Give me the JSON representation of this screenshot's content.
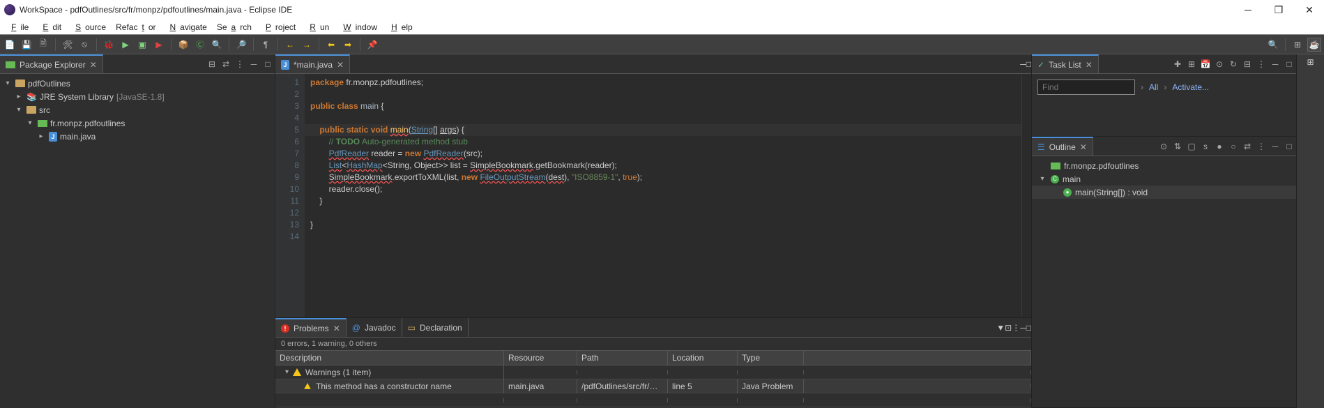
{
  "title": "WorkSpace - pdfOutlines/src/fr/monpz/pdfoutlines/main.java - Eclipse IDE",
  "menu": [
    "File",
    "Edit",
    "Source",
    "Refactor",
    "Navigate",
    "Search",
    "Project",
    "Run",
    "Window",
    "Help"
  ],
  "menu_mnemonic": [
    "F",
    "E",
    "S",
    "t",
    "N",
    "a",
    "P",
    "R",
    "W",
    "H"
  ],
  "pkgexp": {
    "title": "Package Explorer",
    "project": "pdfOutlines",
    "jre": {
      "label": "JRE System Library",
      "version": "[JavaSE-1.8]"
    },
    "srcfolder": "src",
    "pkg": "fr.monpz.pdfoutlines",
    "file": "main.java"
  },
  "editor": {
    "tab": "*main.java",
    "lines": [
      {
        "n": 1,
        "html": "<span class='kw'>package</span> fr.monpz.pdfoutlines;"
      },
      {
        "n": 2,
        "html": ""
      },
      {
        "n": 3,
        "html": "<span class='kw'>public class</span> <span style='color:#a9b7c6'>main</span> {"
      },
      {
        "n": 4,
        "html": ""
      },
      {
        "n": 5,
        "html": "    <span class='kw'>public static void</span> <span class='mth err'>main</span>(<span class='cls'>String</span>[] <span style='text-decoration:underline'>args</span>) {",
        "marker": "warn-hl"
      },
      {
        "n": 6,
        "html": "        <span class='cmt'>// <b>TODO</b> Auto-generated method stub</span>"
      },
      {
        "n": 7,
        "html": "        <span class='cls err'>PdfReader</span> reader = <span class='kw'>new</span> <span class='cls err'>PdfReader</span>(src);",
        "marker": "err"
      },
      {
        "n": 8,
        "html": "        <span class='cls err'>List</span>&lt;<span class='cls err'>HashMap</span>&lt;String, Object&gt;&gt; list = <span class='err'>SimpleBookmark</span>.getBookmark(reader);",
        "marker": "err"
      },
      {
        "n": 9,
        "html": "        <span class='err'>SimpleBookmark</span>.exportToXML(list, <span class='kw'>new</span> <span class='cls err'>FileOutputStream</span>(<span class='err'>dest</span>), <span class='str'>\"ISO8859-1\"</span>, <span class='litbool'>true</span>);",
        "marker": "err"
      },
      {
        "n": 10,
        "html": "        reader.close();"
      },
      {
        "n": 11,
        "html": "    }"
      },
      {
        "n": 12,
        "html": ""
      },
      {
        "n": 13,
        "html": "}"
      },
      {
        "n": 14,
        "html": ""
      }
    ]
  },
  "problems": {
    "tabs": [
      "Problems",
      "Javadoc",
      "Declaration"
    ],
    "summary": "0 errors, 1 warning, 0 others",
    "columns": [
      "Description",
      "Resource",
      "Path",
      "Location",
      "Type"
    ],
    "group": "Warnings (1 item)",
    "row": {
      "desc": "This method has a constructor name",
      "res": "main.java",
      "path": "/pdfOutlines/src/fr/m...",
      "loc": "line 5",
      "type": "Java Problem"
    }
  },
  "tasklist": {
    "title": "Task List",
    "placeholder": "Find",
    "all": "All",
    "activate": "Activate..."
  },
  "outline": {
    "title": "Outline",
    "pkg": "fr.monpz.pdfoutlines",
    "cls": "main",
    "mth": "main(String[]) : void"
  }
}
